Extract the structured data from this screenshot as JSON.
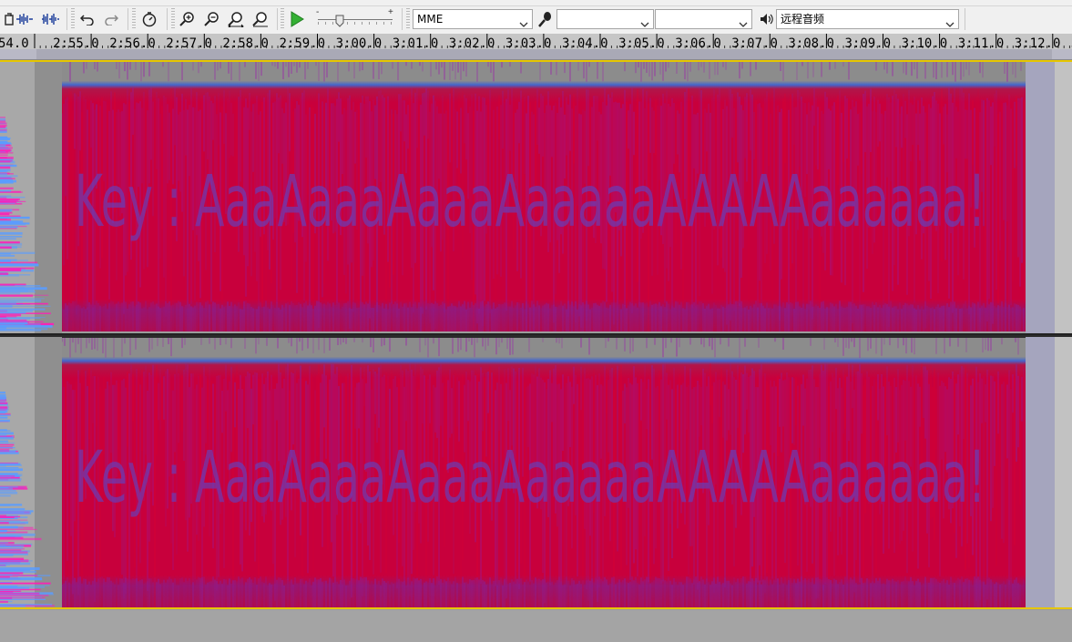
{
  "toolbar": {
    "host": "MME",
    "recording_device": "",
    "recording_channels": "",
    "playback_device": "远程音频"
  },
  "timeline": {
    "labels": [
      "54.0",
      "2:55.0",
      "2:56.0",
      "2:57.0",
      "2:58.0",
      "2:59.0",
      "3:00.0",
      "3:01.0",
      "3:02.0",
      "3:03.0",
      "3:04.0",
      "3:05.0",
      "3:06.0",
      "3:07.0",
      "3:08.0",
      "3:09.0",
      "3:10.0",
      "3:11.0",
      "3:12.0",
      "3:1"
    ]
  },
  "tracks": [
    {
      "channel": "left",
      "hidden_text": "Key : AaaAaaaAaaaAaaaaaAAAAAaaaaaa!"
    },
    {
      "channel": "right",
      "hidden_text": "Key : AaaAaaaAaaaAaaaaaAAAAAaaaaaa!"
    }
  ],
  "colors": {
    "spectrogram_base": "#c8003c",
    "spectrogram_noise": "#8a1fb0",
    "spectrogram_top_band": "#4466cc",
    "left_panel_blue": "#5a9cff",
    "left_panel_magenta": "#ff1cb8",
    "selection_gray": "#a6a6a6"
  }
}
